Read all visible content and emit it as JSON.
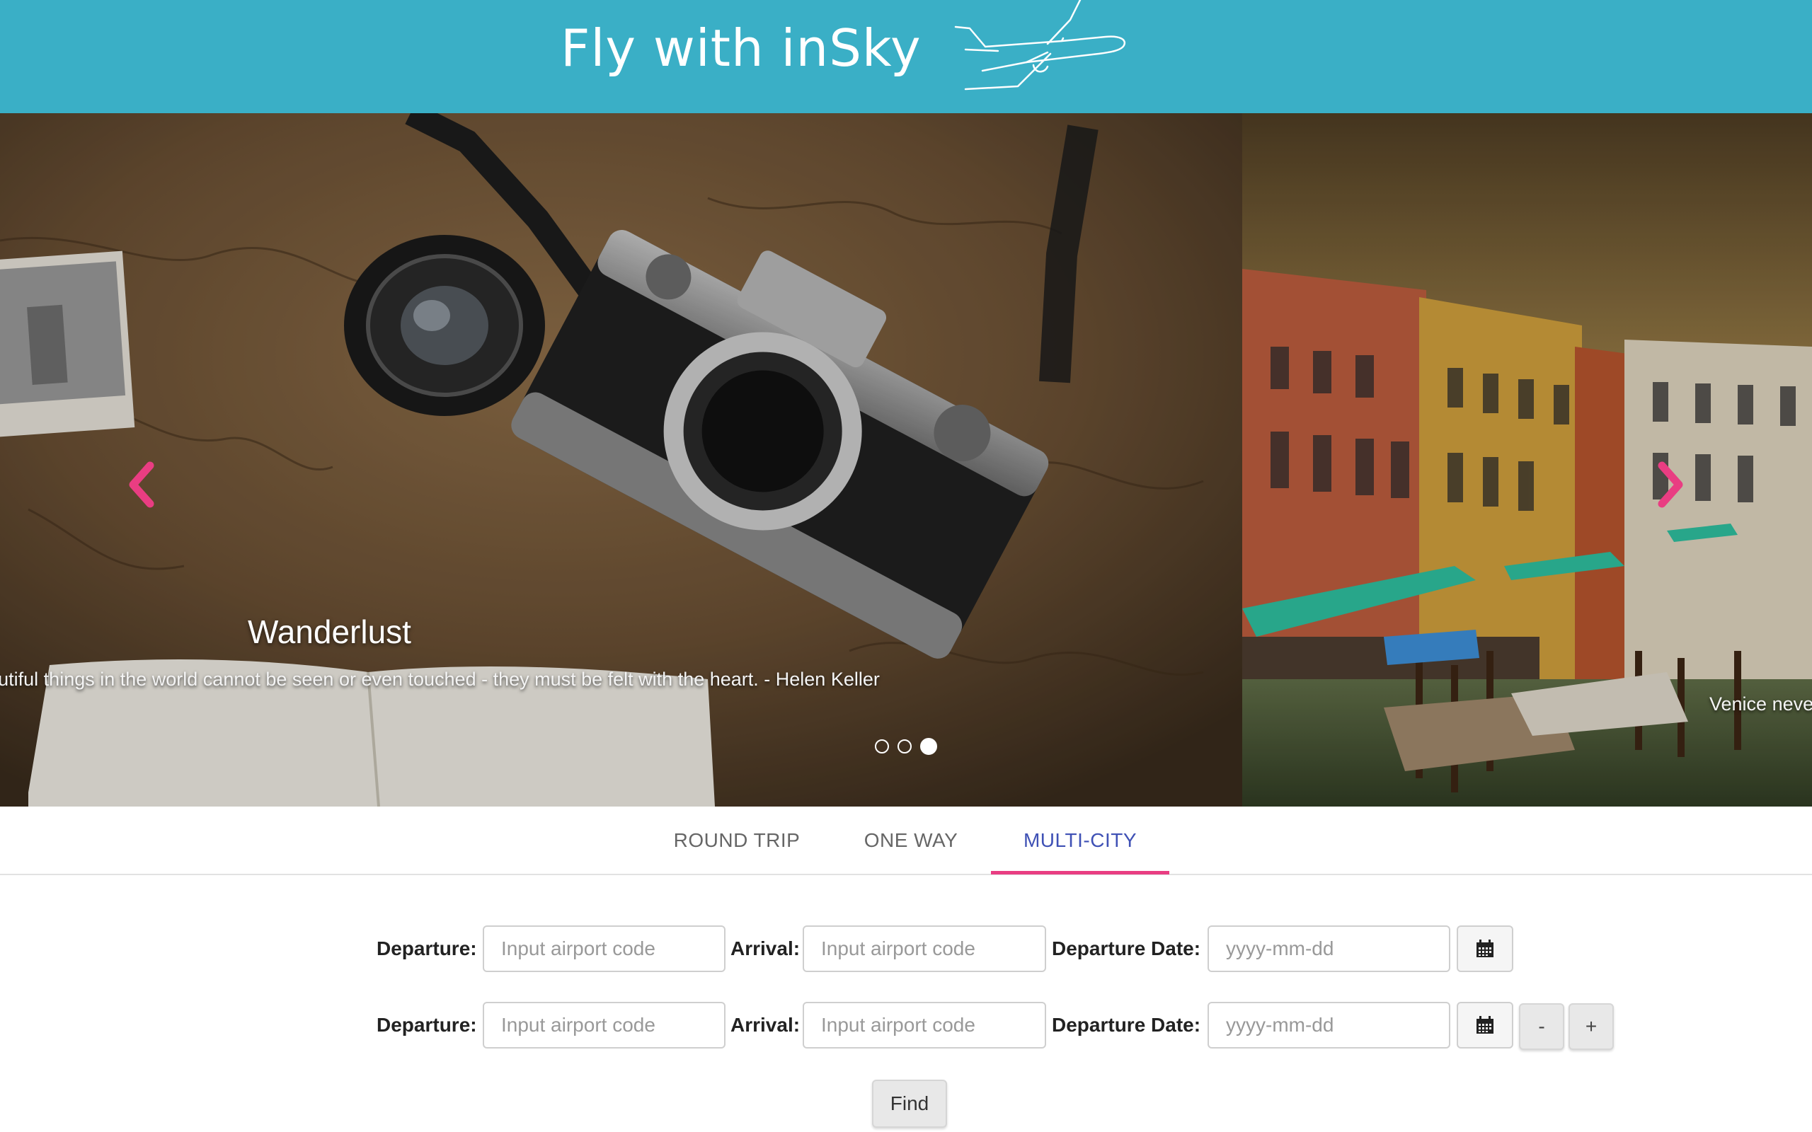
{
  "header": {
    "brand": "Fly with inSky",
    "logo_icon": "airplane-icon"
  },
  "carousel": {
    "slides": [
      {
        "title": "Wanderlust",
        "text": "utiful things in the world cannot be seen or even touched - they must be felt with the heart. - Helen Keller"
      },
      {
        "text": "Venice neve"
      }
    ],
    "indicator_count": 3,
    "active_indicator": 3,
    "prev_icon": "chevron-left-icon",
    "next_icon": "chevron-right-icon",
    "arrow_color": "#e93d82"
  },
  "tabs": {
    "items": [
      {
        "label": "ROUND TRIP"
      },
      {
        "label": "ONE WAY"
      },
      {
        "label": "MULTI-CITY"
      }
    ],
    "active": "MULTI-CITY",
    "active_color": "#3f51b5",
    "underline_color": "#e93d82"
  },
  "form": {
    "legs": [
      {
        "departure_label": "Departure:",
        "departure_placeholder": "Input airport code",
        "arrival_label": "Arrival:",
        "arrival_placeholder": "Input airport code",
        "date_label": "Departure Date:",
        "date_placeholder": "yyyy-mm-dd"
      },
      {
        "departure_label": "Departure:",
        "departure_placeholder": "Input airport code",
        "arrival_label": "Arrival:",
        "arrival_placeholder": "Input airport code",
        "date_label": "Departure Date:",
        "date_placeholder": "yyyy-mm-dd"
      }
    ],
    "calendar_icon": "calendar-icon",
    "remove_label": "-",
    "add_label": "+",
    "find_label": "Find"
  },
  "colors": {
    "header_bg": "#3aafc6"
  }
}
